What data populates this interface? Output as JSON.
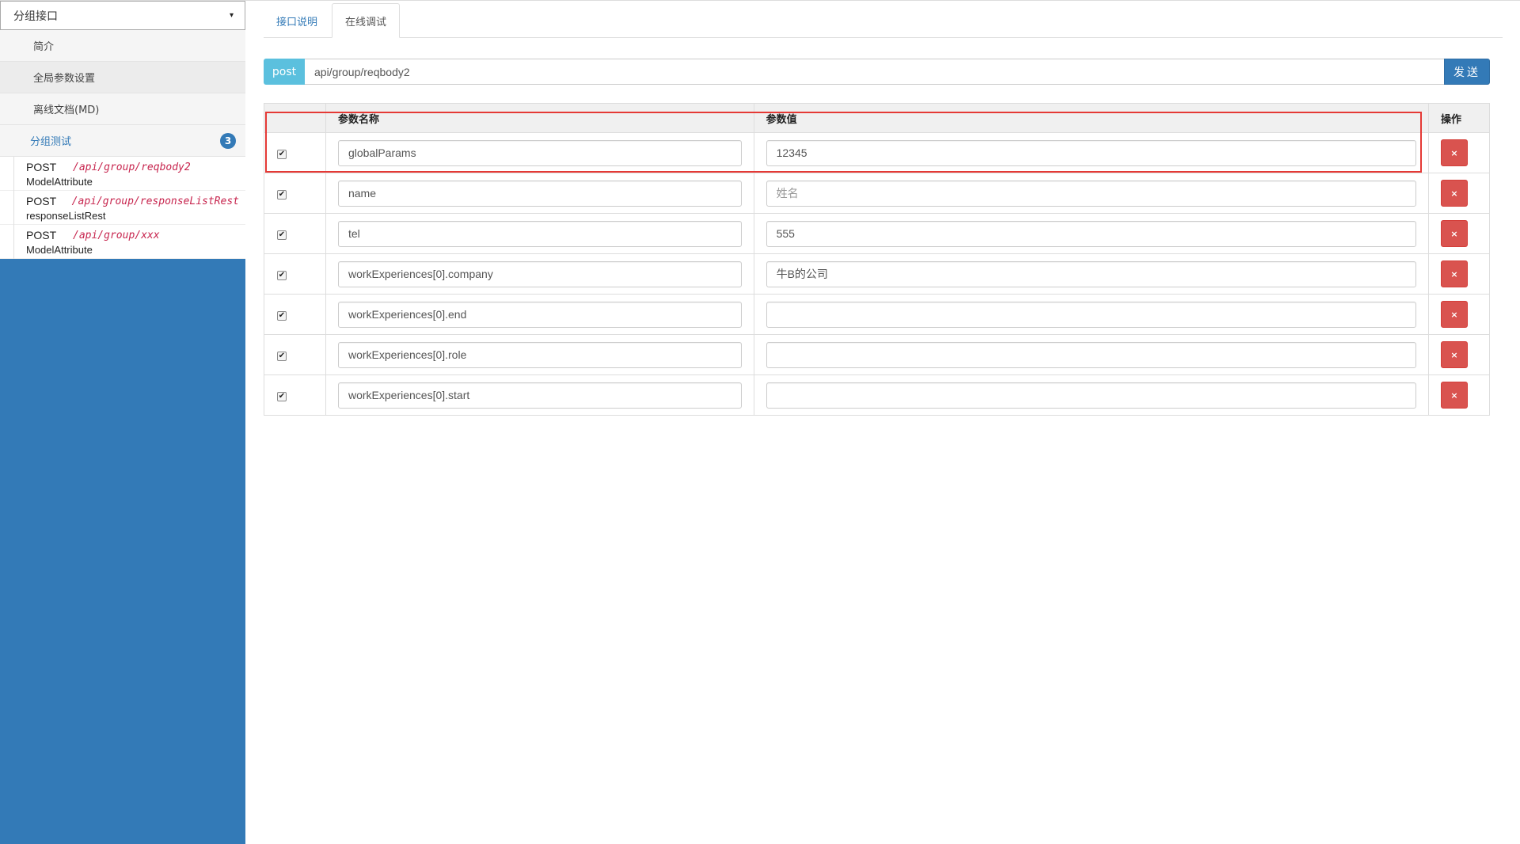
{
  "sidebar": {
    "group_select": {
      "value": "分组接口",
      "caret": "▾"
    },
    "menu": {
      "intro": "简介",
      "global_params": "全局参数设置",
      "offline_doc": "离线文档(MD)",
      "group_test": "分组测试",
      "group_test_count": "3"
    },
    "apis": [
      {
        "method": "POST",
        "path": "/api/group/reqbody2",
        "summary": "ModelAttribute"
      },
      {
        "method": "POST",
        "path": "/api/group/responseListRest",
        "summary": "responseListRest"
      },
      {
        "method": "POST",
        "path": "/api/group/xxx",
        "summary": "ModelAttribute"
      }
    ]
  },
  "tabs": {
    "doc": "接口说明",
    "debug": "在线调试"
  },
  "request": {
    "method": "post",
    "url": "api/group/reqbody2",
    "send_label": "发送"
  },
  "table": {
    "headers": {
      "name": "参数名称",
      "value": "参数值",
      "op": "操作"
    },
    "rows": [
      {
        "checked": true,
        "name": "globalParams",
        "value": "12345",
        "placeholder": ""
      },
      {
        "checked": true,
        "name": "name",
        "value": "",
        "placeholder": "姓名"
      },
      {
        "checked": true,
        "name": "tel",
        "value": "555",
        "placeholder": ""
      },
      {
        "checked": true,
        "name": "workExperiences[0].company",
        "value": "牛B的公司",
        "placeholder": ""
      },
      {
        "checked": true,
        "name": "workExperiences[0].end",
        "value": "",
        "placeholder": ""
      },
      {
        "checked": true,
        "name": "workExperiences[0].role",
        "value": "",
        "placeholder": ""
      },
      {
        "checked": true,
        "name": "workExperiences[0].start",
        "value": "",
        "placeholder": ""
      }
    ],
    "check_glyph": "✔",
    "delete_glyph": "×"
  },
  "colors": {
    "sidebar_bg": "#337ab7",
    "method_addon": "#5bc0de",
    "send_button": "#337ab7",
    "delete_button": "#d9534f",
    "highlight": "#e53935",
    "api_path": "#c7254e"
  },
  "icons": {
    "caret": "chevron-down-icon",
    "check": "checkmark-icon",
    "delete": "close-icon"
  }
}
